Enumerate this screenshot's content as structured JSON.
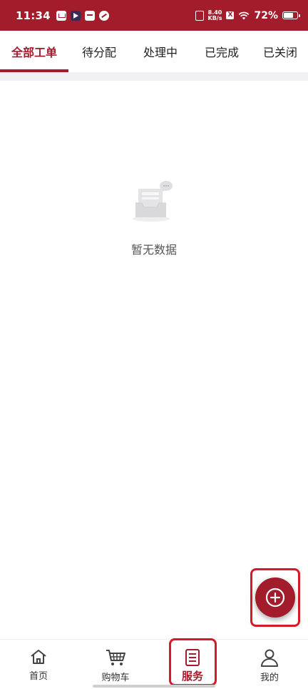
{
  "status_bar": {
    "time": "11:34",
    "net_speed_value": "8.40",
    "net_speed_unit": "KB/s",
    "x_badge": "X",
    "battery": "72%",
    "battery_level": 0.72
  },
  "tabs": [
    {
      "label": "全部工单",
      "active": true
    },
    {
      "label": "待分配",
      "active": false
    },
    {
      "label": "处理中",
      "active": false
    },
    {
      "label": "已完成",
      "active": false
    },
    {
      "label": "已关闭",
      "active": false
    }
  ],
  "empty_state": {
    "text": "暂无数据"
  },
  "bottom_nav": [
    {
      "label": "首页",
      "icon": "home-icon",
      "active": false
    },
    {
      "label": "购物车",
      "icon": "cart-icon",
      "active": false
    },
    {
      "label": "服务",
      "icon": "service-icon",
      "active": true
    },
    {
      "label": "我的",
      "icon": "profile-icon",
      "active": false
    }
  ],
  "colors": {
    "brand": "#a31c2b",
    "highlight": "#d61a2a",
    "divider": "#f1f1f3"
  },
  "fab": {
    "icon": "plus-circle-icon"
  }
}
